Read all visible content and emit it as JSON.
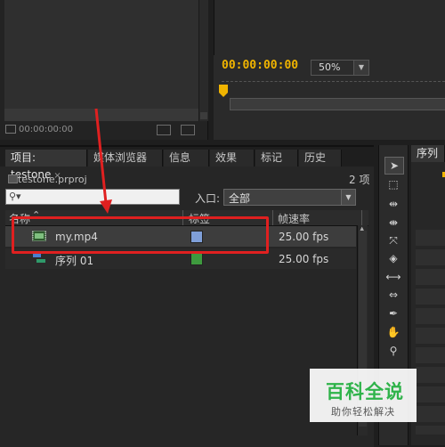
{
  "source_monitor": {
    "timecode": "00:00:00:00"
  },
  "program_monitor": {
    "timecode": "00:00:00:00",
    "zoom": "50%"
  },
  "project_panel": {
    "tabs": [
      {
        "label": "项目: testone",
        "close": "×"
      },
      {
        "label": "媒体浏览器"
      },
      {
        "label": "信息"
      },
      {
        "label": "效果"
      },
      {
        "label": "标记"
      },
      {
        "label": "历史"
      }
    ],
    "filename": "testone.prproj",
    "item_count": "2 项",
    "entry_label": "入口:",
    "entry_value": "全部",
    "columns": {
      "name": "名称",
      "label": "标签",
      "frame_rate": "帧速率"
    },
    "rows": [
      {
        "name": "my.mp4",
        "frame_rate": "25.00 fps",
        "label_color": "#7f9fd8"
      },
      {
        "name": "序列 01",
        "frame_rate": "25.00 fps",
        "label_color": "#3e9a3e"
      }
    ]
  },
  "sequence_panel": {
    "tab_label": "序列"
  },
  "watermark": {
    "title": "百科全说",
    "subtitle": "助你轻松解决"
  }
}
